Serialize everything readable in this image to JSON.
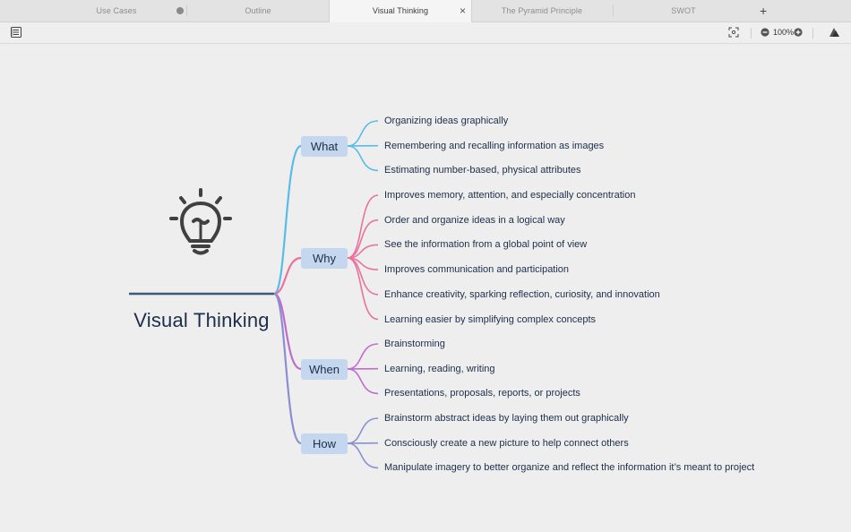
{
  "tabs": [
    {
      "label": "Use Cases"
    },
    {
      "label": "Outline"
    },
    {
      "label": "Visual Thinking",
      "active": true
    },
    {
      "label": "The Pyramid Principle"
    },
    {
      "label": "SWOT"
    }
  ],
  "toolbar": {
    "zoom_level": "100%"
  },
  "map": {
    "central_topic": "Visual Thinking",
    "branches": [
      {
        "label": "What",
        "color": "#5bbbe8",
        "items": [
          "Organizing ideas graphically",
          "Remembering and recalling information as images",
          "Estimating number-based, physical attributes"
        ]
      },
      {
        "label": "Why",
        "color": "#e8739b",
        "items": [
          "Improves memory, attention, and especially concentration",
          "Order and organize ideas in a logical way",
          "See the information from a global point of view",
          "Improves communication and participation",
          "Enhance creativity, sparking reflection, curiosity, and innovation",
          "Learning easier by simplifying complex concepts"
        ]
      },
      {
        "label": "When",
        "color": "#c06ccc",
        "items": [
          "Brainstorming",
          "Learning, reading, writing",
          "Presentations, proposals, reports, or projects"
        ]
      },
      {
        "label": "How",
        "color": "#8a8fd0",
        "items": [
          "Brainstorm abstract ideas by laying them out graphically",
          "Consciously create a new picture to help connect others",
          "Manipulate imagery to better organize and reflect the information it’s meant to project"
        ]
      }
    ]
  },
  "colors": {
    "central_line": "#3f5878",
    "branch_box": "#c5d7ef",
    "text": "#1c2e4a"
  }
}
